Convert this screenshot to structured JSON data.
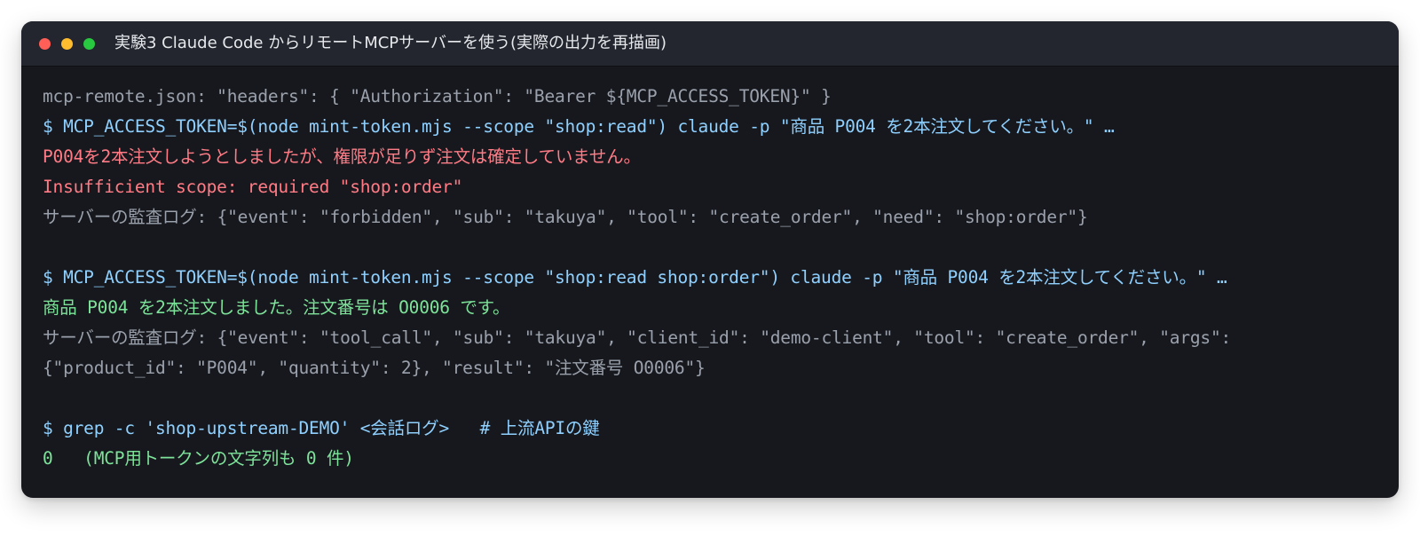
{
  "window": {
    "title": "実験3 Claude Code からリモートMCPサーバーを使う(実際の出力を再描画)"
  },
  "colors": {
    "background": "#16181d",
    "titlebar": "#23262e",
    "dim": "#9ba1ac",
    "command": "#8fd0ff",
    "error": "#ff7b85",
    "success": "#7ee39a"
  },
  "terminal": {
    "lines": [
      "mcp-remote.json: \"headers\": { \"Authorization\": \"Bearer ${MCP_ACCESS_TOKEN}\" }",
      "$ MCP_ACCESS_TOKEN=$(node mint-token.mjs --scope \"shop:read\") claude -p \"商品 P004 を2本注文してください。\" …",
      "P004を2本注文しようとしましたが、権限が足りず注文は確定していません。",
      "Insufficient scope: required \"shop:order\"",
      "サーバーの監査ログ: {\"event\": \"forbidden\", \"sub\": \"takuya\", \"tool\": \"create_order\", \"need\": \"shop:order\"}",
      "$ MCP_ACCESS_TOKEN=$(node mint-token.mjs --scope \"shop:read shop:order\") claude -p \"商品 P004 を2本注文してください。\" …",
      "商品 P004 を2本注文しました。注文番号は O0006 です。",
      "サーバーの監査ログ: {\"event\": \"tool_call\", \"sub\": \"takuya\", \"client_id\": \"demo-client\", \"tool\": \"create_order\", \"args\":",
      "{\"product_id\": \"P004\", \"quantity\": 2}, \"result\": \"注文番号 O0006\"}",
      "$ grep -c 'shop-upstream-DEMO' <会話ログ>   # 上流APIの鍵",
      "0   (MCP用トークンの文字列も 0 件)"
    ]
  }
}
